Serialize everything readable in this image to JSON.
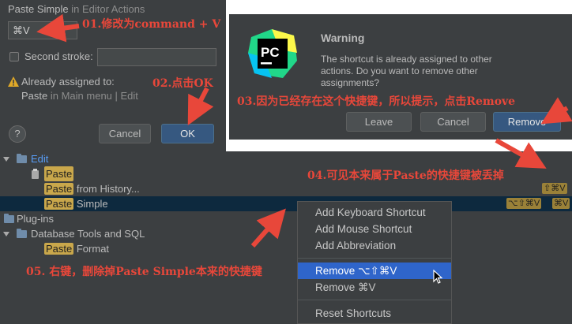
{
  "shortcut_dialog": {
    "title": "Paste Simple",
    "title_suffix": "in Editor Actions",
    "keystroke_value": "⌘V",
    "second_stroke_label": "Second stroke:",
    "second_stroke_value": "",
    "assigned_label": "Already assigned to:",
    "assigned_action": "Paste",
    "assigned_detail": "in Main menu | Edit",
    "help_label": "?",
    "cancel_label": "Cancel",
    "ok_label": "OK"
  },
  "warning_dialog": {
    "title": "Warning",
    "message": "The shortcut is already assigned to other actions. Do you want to remove other assignments?",
    "logo_text": "PC",
    "leave_label": "Leave",
    "cancel_label": "Cancel",
    "remove_label": "Remove"
  },
  "keymap_tree": {
    "edit_folder": "Edit",
    "paste_item": "Paste",
    "paste_from_history_prefix": "Paste",
    "paste_from_history_suffix": " from History...",
    "paste_from_history_shortcut": "⇧⌘V",
    "paste_simple_prefix": "Paste",
    "paste_simple_suffix": " Simple",
    "paste_simple_shortcut_1": "⌥⇧⌘V",
    "paste_simple_shortcut_2": "⌘V",
    "plugins_folder": "Plug-ins",
    "db_folder": "Database Tools and SQL",
    "paste_format_prefix": "Paste",
    "paste_format_suffix": " Format"
  },
  "context_menu": {
    "items": [
      "Add Keyboard Shortcut",
      "Add Mouse Shortcut",
      "Add Abbreviation",
      "Remove ⌥⇧⌘V",
      "Remove ⌘V",
      "Reset Shortcuts"
    ],
    "selected_index": 3
  },
  "annotations": {
    "a1": "01.修改为command + V",
    "a2": "02.点击OK",
    "a3": "03.因为已经存在这个快捷键，所以提示，点击Remove",
    "a4": "04.可见本来属于Paste的快捷键被丢掉",
    "a5": "05. 右键，删除掉Paste Simple本来的快捷键"
  },
  "colors": {
    "dialog_bg": "#3c3f41",
    "primary_button": "#365880",
    "menu_selected": "#2f65ca",
    "search_highlight": "#c9a74b",
    "annotation_red": "#e8473a"
  }
}
